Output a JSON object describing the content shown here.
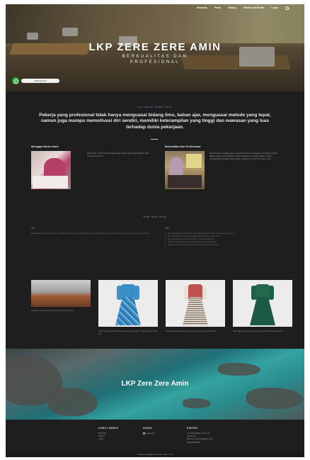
{
  "nav": {
    "items": [
      "Beranda",
      "Profil",
      "Gallery",
      "Media Dan Berita",
      "Login"
    ],
    "search_icon": "search-icon"
  },
  "hero": {
    "title": "LKP ZERE ZERE AMIN",
    "subtitle_line1": "BERKUALITAS DAN",
    "subtitle_line2": "PROFESIONAL",
    "whatsapp_icon": "whatsapp-icon",
    "contact_label": "Hubungi Kami"
  },
  "about": {
    "eyebrow": "LKP ZERE ZERE AMIN",
    "lead": "Pekerja yang profesional tidak hanya menguasai bidang ilmu, bahan ajar, menguasai metode yang tepat, namun juga mampu memotivasi diri sendiri, memiliki keterampilan yang tinggi dan wawasan yang luas terhadap dunia pekerjaan.",
    "cards": [
      {
        "title": "Mengapa Harus Kami",
        "text": "Kami akan memberikan berbagai kesempatan yang tidak dibatasi oleh kemampuan kamu."
      },
      {
        "title": "Berkualitas Dan Profesional",
        "text": "Berkontribusi pengajar yang memiliki kompetensi sebagai guru dalam praktik dalam rangka meningkatkan hasil pendidikan dan keterampilan. Untuk meningkatkan kualitas siswa dalam praktik di era LKP Zere Zere Amin."
      }
    ]
  },
  "visi_misi": {
    "title": "VISI DAN MISI",
    "visi_head": "Visi",
    "visi_text": "Menjadikan LKP Zere Zere Amin sebagai lembaga kursus dan pelatihan yang unggul dalam menciptakan tenaga kerja yang terampil dan mandiri.",
    "misi_head": "Misi",
    "misi_items": [
      "Menyelenggarakan pendidikan dan pelatihan keterampilan menjahit yang bermutu.",
      "Mengembangkan kreativitas peserta didik di bidang tata busana.",
      "Meningkatkan kompetensi instruktur secara berkelanjutan.",
      "Menjalin kerja sama dengan dunia usaha dan dunia industri.",
      "Menyiapkan lulusan yang siap kerja dan berwirausaha mandiri."
    ]
  },
  "gallery": [
    {
      "caption": "Kegiatan praktik menjahit bersama peserta kursus"
    },
    {
      "caption": "Hasil karya peserta kursus berupa gaun dengan motif bunga berwarna biru"
    },
    {
      "caption": "Hasil karya peserta kursus berupa gaun dengan motif kotak"
    },
    {
      "caption": "Hasil karya peserta kursus berupa gaun berwarna hijau tua"
    }
  ],
  "banner": {
    "title": "LKP Zere Zere Amin"
  },
  "footer": {
    "links_head": "LINKS LAINNYA",
    "links": [
      "Beranda",
      "Gallery",
      "Login"
    ],
    "social_head": "SOSIAL",
    "social": [
      "Instagram"
    ],
    "contact_head": "KONTAK",
    "contact": [
      "Jl. Pulau Belitung No. 10",
      "Indonesia",
      "lkpzerezereamin@gmail.com",
      "081234567890"
    ],
    "copyright": "© 2024 Copyright LKP Zere Zere Amin"
  },
  "colors": {
    "page_bg": "#1e1e1e",
    "accent_text": "#7fa8d8",
    "whatsapp": "#2fb344"
  }
}
